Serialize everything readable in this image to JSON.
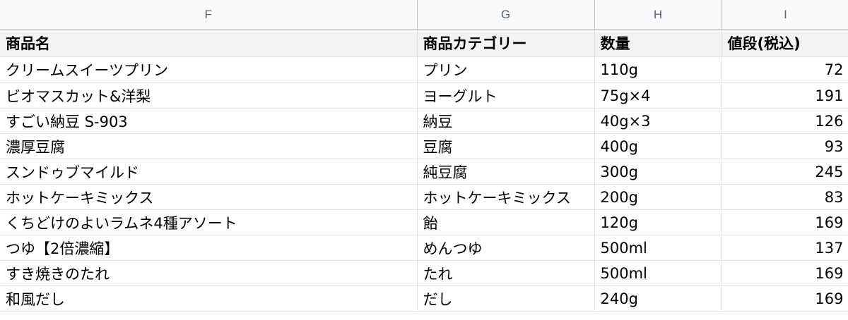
{
  "columns": [
    "F",
    "G",
    "H",
    "I"
  ],
  "header": {
    "name": "商品名",
    "category": "商品カテゴリー",
    "quantity": "数量",
    "price": "値段(税込)"
  },
  "rows": [
    {
      "name": "クリームスイーツプリン",
      "category": "プリン",
      "quantity": "110g",
      "price": "72"
    },
    {
      "name": "ビオマスカット&洋梨",
      "category": "ヨーグルト",
      "quantity": "75g×4",
      "price": "191"
    },
    {
      "name": "すごい納豆 S-903",
      "category": "納豆",
      "quantity": "40g×3",
      "price": "126"
    },
    {
      "name": "濃厚豆腐",
      "category": "豆腐",
      "quantity": "400g",
      "price": "93"
    },
    {
      "name": "スンドゥブマイルド",
      "category": "純豆腐",
      "quantity": "300g",
      "price": "245"
    },
    {
      "name": "ホットケーキミックス",
      "category": "ホットケーキミックス",
      "quantity": "200g",
      "price": "83"
    },
    {
      "name": "くちどけのよいラムネ4種アソート",
      "category": "飴",
      "quantity": "120g",
      "price": "169"
    },
    {
      "name": "つゆ【2倍濃縮】",
      "category": "めんつゆ",
      "quantity": "500ml",
      "price": "137"
    },
    {
      "name": "すき焼きのたれ",
      "category": "たれ",
      "quantity": "500ml",
      "price": "169"
    },
    {
      "name": "和風だし",
      "category": "だし",
      "quantity": "240g",
      "price": "169"
    }
  ]
}
